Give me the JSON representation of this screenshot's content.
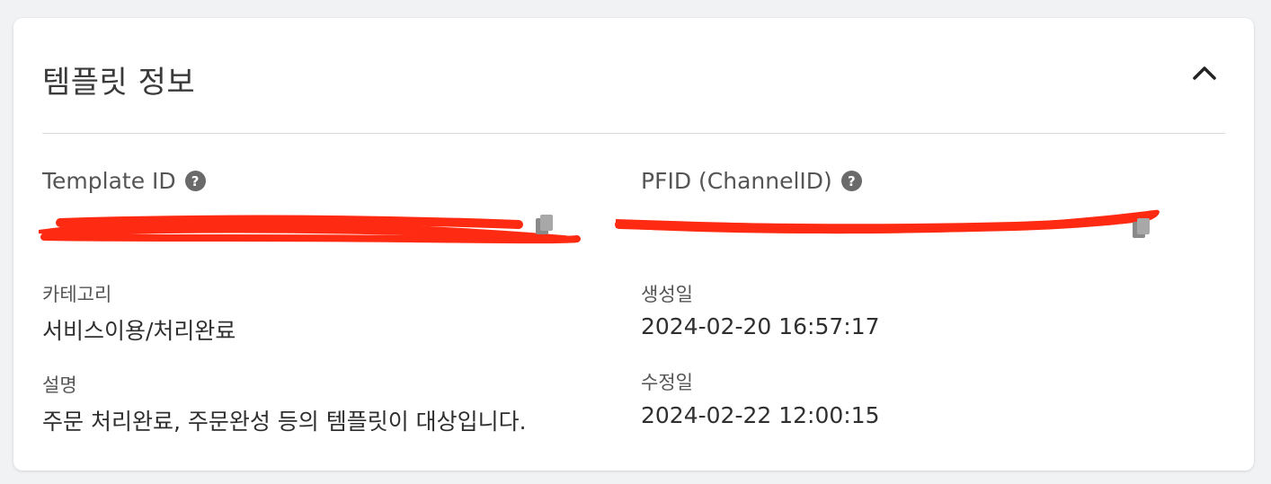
{
  "panel": {
    "title": "템플릿 정보"
  },
  "fields": {
    "template_id": {
      "label": "Template ID"
    },
    "pfid": {
      "label": "PFID (ChannelID)"
    },
    "category": {
      "label": "카테고리",
      "value": "서비스이용/처리완료"
    },
    "created": {
      "label": "생성일",
      "value": "2024-02-20 16:57:17"
    },
    "description": {
      "label": "설명",
      "value": "주문 처리완료, 주문완성 등의 템플릿이 대상입니다."
    },
    "modified": {
      "label": "수정일",
      "value": "2024-02-22 12:00:15"
    }
  },
  "icons": {
    "collapse": "chevron-up-icon",
    "help": "question-circle-icon",
    "copy": "copy-icon"
  },
  "colors": {
    "redaction": "#ff2a12",
    "help_icon": "#6a6a6a"
  }
}
